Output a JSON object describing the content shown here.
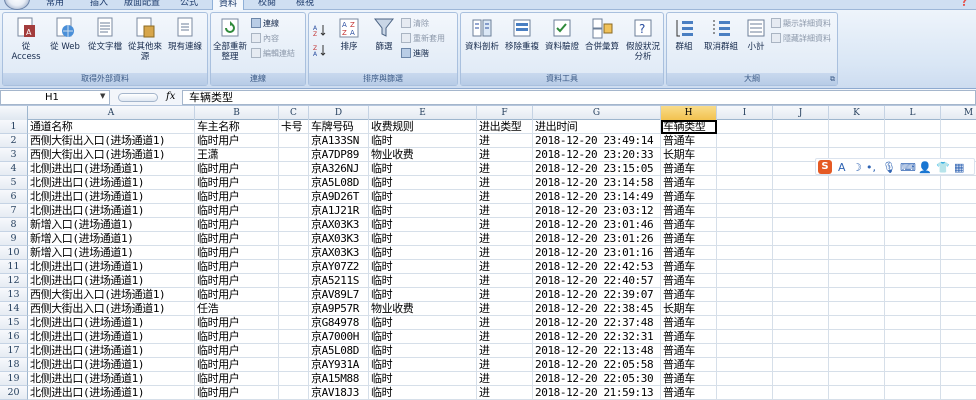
{
  "tabs": [
    {
      "label": "常用",
      "active": false
    },
    {
      "label": "插入",
      "active": false
    },
    {
      "label": "版面配置",
      "active": false
    },
    {
      "label": "公式",
      "active": false
    },
    {
      "label": "資料",
      "active": true
    },
    {
      "label": "校閱",
      "active": false
    },
    {
      "label": "檢視",
      "active": false
    }
  ],
  "ribbon": {
    "external_group": {
      "title": "取得外部資料",
      "access": "從 Access",
      "web": "從 Web",
      "text": "從文字檔",
      "other": "從其他來源",
      "existing": "現有連線"
    },
    "connections_group": {
      "title": "連線",
      "refresh_all": "全部重新整理",
      "connections": "連線",
      "properties": "內容",
      "edit_links": "編輯連結"
    },
    "sort_group": {
      "title": "排序與篩選",
      "sort": "排序",
      "filter": "篩選",
      "clear": "清除",
      "reapply": "重新套用",
      "advanced": "進階"
    },
    "tools_group": {
      "title": "資料工具",
      "text_to_columns": "資料剖析",
      "remove_duplicates": "移除重複",
      "validation": "資料驗證",
      "consolidate": "合併彙算",
      "what_if": "假設狀況分析"
    },
    "outline_group": {
      "title": "大綱",
      "group": "群組",
      "ungroup": "取消群組",
      "subtotal": "小計",
      "show_detail": "顯示詳細資料",
      "hide_detail": "隱藏詳細資料"
    }
  },
  "formula_bar": {
    "name_box": "H1",
    "formula": "车辆类型"
  },
  "columns": [
    "A",
    "B",
    "C",
    "D",
    "E",
    "F",
    "G",
    "H",
    "I",
    "J",
    "K",
    "L",
    "M"
  ],
  "selected_column": "H",
  "rows": [
    {
      "n": "1",
      "cells": [
        "通道名称",
        "车主名称",
        "卡号",
        "车牌号码",
        "收费规则",
        "进出类型",
        "进出时间",
        "车辆类型"
      ]
    },
    {
      "n": "2",
      "cells": [
        "西侧大街出入口(进场通道1)",
        "临时用户",
        "",
        "京A133SN",
        "临时",
        "进",
        "2018-12-20 23:49:14",
        "普通车"
      ]
    },
    {
      "n": "3",
      "cells": [
        "西侧大街出入口(进场通道1)",
        "王潇",
        "",
        "京A7DP89",
        "物业收费",
        "进",
        "2018-12-20 23:20:33",
        "长期车"
      ]
    },
    {
      "n": "4",
      "cells": [
        "北侧进出口(进场通道1)",
        "临时用户",
        "",
        "京A326NJ",
        "临时",
        "进",
        "2018-12-20 23:15:05",
        "普通车"
      ]
    },
    {
      "n": "5",
      "cells": [
        "北侧进出口(进场通道1)",
        "临时用户",
        "",
        "京A5L08D",
        "临时",
        "进",
        "2018-12-20 23:14:58",
        "普通车"
      ]
    },
    {
      "n": "6",
      "cells": [
        "北侧进出口(进场通道1)",
        "临时用户",
        "",
        "京A9D26T",
        "临时",
        "进",
        "2018-12-20 23:14:49",
        "普通车"
      ]
    },
    {
      "n": "7",
      "cells": [
        "北侧进出口(进场通道1)",
        "临时用户",
        "",
        "京A1J21R",
        "临时",
        "进",
        "2018-12-20 23:03:12",
        "普通车"
      ]
    },
    {
      "n": "8",
      "cells": [
        "新增入口(进场通道1)",
        "临时用户",
        "",
        "京AX03K3",
        "临时",
        "进",
        "2018-12-20 23:01:46",
        "普通车"
      ]
    },
    {
      "n": "9",
      "cells": [
        "新增入口(进场通道1)",
        "临时用户",
        "",
        "京AX03K3",
        "临时",
        "进",
        "2018-12-20 23:01:26",
        "普通车"
      ]
    },
    {
      "n": "10",
      "cells": [
        "新增入口(进场通道1)",
        "临时用户",
        "",
        "京AX03K3",
        "临时",
        "进",
        "2018-12-20 23:01:16",
        "普通车"
      ]
    },
    {
      "n": "11",
      "cells": [
        "北侧进出口(进场通道1)",
        "临时用户",
        "",
        "京AY07Z2",
        "临时",
        "进",
        "2018-12-20 22:42:53",
        "普通车"
      ]
    },
    {
      "n": "12",
      "cells": [
        "北侧进出口(进场通道1)",
        "临时用户",
        "",
        "京A5211S",
        "临时",
        "进",
        "2018-12-20 22:40:57",
        "普通车"
      ]
    },
    {
      "n": "13",
      "cells": [
        "西侧大街出入口(进场通道1)",
        "临时用户",
        "",
        "京AV89L7",
        "临时",
        "进",
        "2018-12-20 22:39:07",
        "普通车"
      ]
    },
    {
      "n": "14",
      "cells": [
        "西侧大街出入口(进场通道1)",
        "任浩",
        "",
        "京A9P57R",
        "物业收费",
        "进",
        "2018-12-20 22:38:45",
        "长期车"
      ]
    },
    {
      "n": "15",
      "cells": [
        "北侧进出口(进场通道1)",
        "临时用户",
        "",
        "京G84978",
        "临时",
        "进",
        "2018-12-20 22:37:48",
        "普通车"
      ]
    },
    {
      "n": "16",
      "cells": [
        "北侧进出口(进场通道1)",
        "临时用户",
        "",
        "京A7000H",
        "临时",
        "进",
        "2018-12-20 22:32:31",
        "普通车"
      ]
    },
    {
      "n": "17",
      "cells": [
        "北侧进出口(进场通道1)",
        "临时用户",
        "",
        "京A5L08D",
        "临时",
        "进",
        "2018-12-20 22:13:48",
        "普通车"
      ]
    },
    {
      "n": "18",
      "cells": [
        "北侧进出口(进场通道1)",
        "临时用户",
        "",
        "京AY931A",
        "临时",
        "进",
        "2018-12-20 22:05:58",
        "普通车"
      ]
    },
    {
      "n": "19",
      "cells": [
        "北侧进出口(进场通道1)",
        "临时用户",
        "",
        "京A15M88",
        "临时",
        "进",
        "2018-12-20 22:05:30",
        "普通车"
      ]
    },
    {
      "n": "20",
      "cells": [
        "北侧进出口(进场通道1)",
        "临时用户",
        "",
        "京AV18J3",
        "临时",
        "进",
        "2018-12-20 21:59:13",
        "普通车"
      ]
    }
  ],
  "ime_toolbar": {
    "logo": "S",
    "lang": "A"
  },
  "colors": {
    "ribbon_bg": "#d9e6f5",
    "selected_header": "#f2c24f",
    "brand_orange": "#e55a24"
  }
}
